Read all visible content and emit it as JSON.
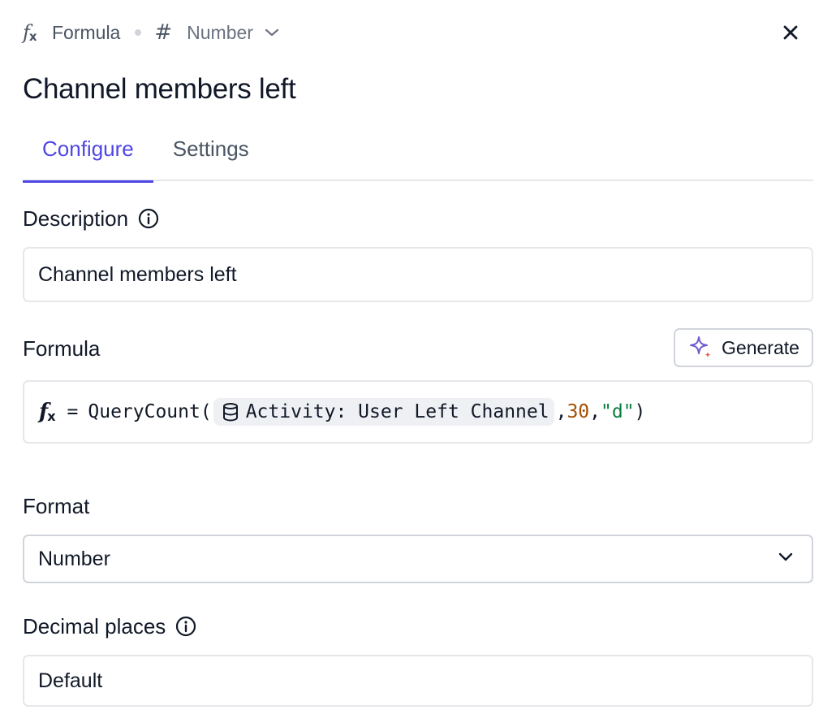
{
  "header": {
    "type_icon": "fx-icon",
    "type_label": "Formula",
    "format_icon": "hash-icon",
    "format_label": "Number"
  },
  "title": "Channel members left",
  "tabs": [
    {
      "label": "Configure",
      "active": true
    },
    {
      "label": "Settings",
      "active": false
    }
  ],
  "description": {
    "label": "Description",
    "value": "Channel members left"
  },
  "formula": {
    "label": "Formula",
    "generate_label": "Generate",
    "fx_symbol": "f",
    "fx_sub": "x",
    "equals": "=",
    "function_name": "QueryCount(",
    "source_chip": "Activity: User Left Channel",
    "comma1": ",",
    "arg_number": "30",
    "comma2": ",",
    "arg_string": "\"d\"",
    "close_paren": ")"
  },
  "format": {
    "label": "Format",
    "selected": "Number"
  },
  "decimal_places": {
    "label": "Decimal places",
    "value": "Default"
  },
  "colors": {
    "accent": "#4f46e5",
    "number_token": "#a44d00",
    "string_token": "#0a7d3f"
  }
}
